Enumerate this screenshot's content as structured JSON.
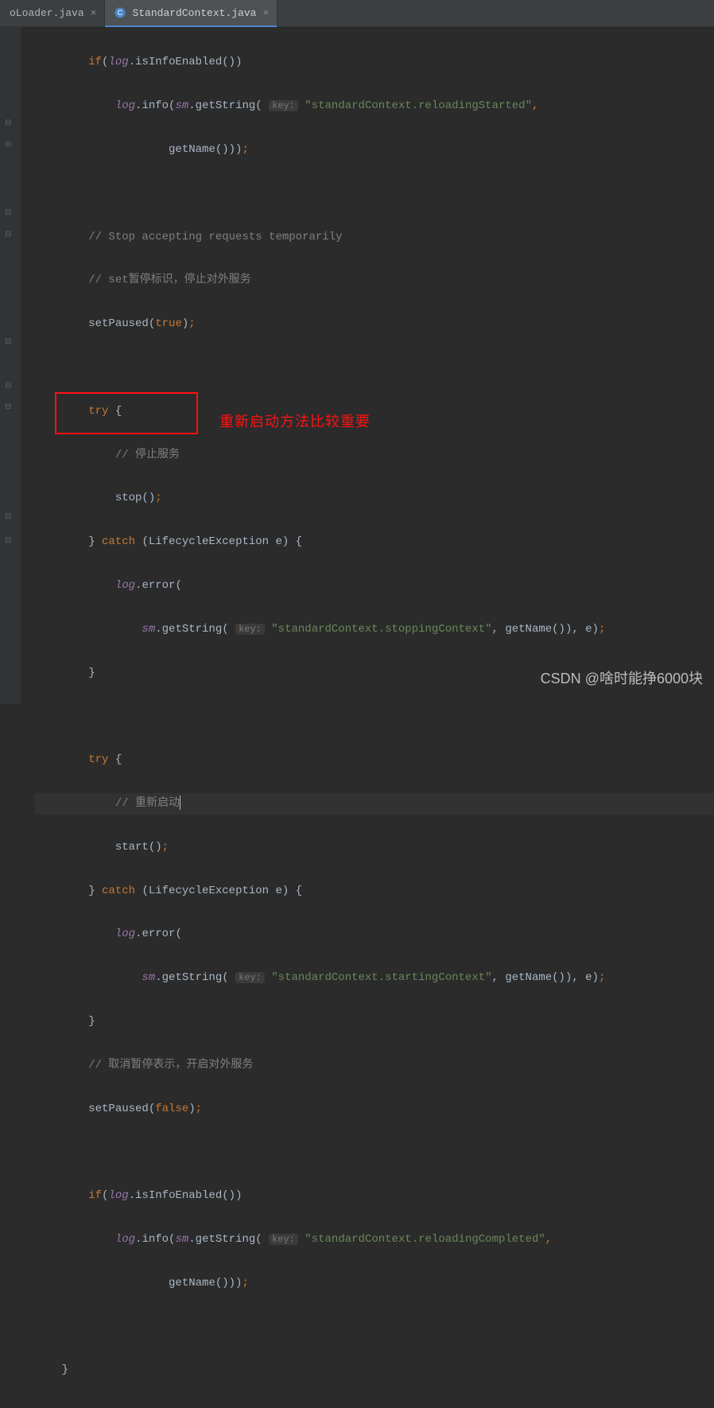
{
  "tabs": [
    {
      "label": "oLoader.java",
      "active": false,
      "icon": "none"
    },
    {
      "label": "StandardContext.java",
      "active": true,
      "icon": "class-icon"
    }
  ],
  "annotation": {
    "text": "重新启动方法比较重要"
  },
  "watermark": "CSDN @啥时能挣6000块",
  "code": {
    "l1a": "if",
    "l1b": "(",
    "l1c": "log",
    "l1d": ".isInfoEnabled())",
    "l2a": "log",
    "l2b": ".info(",
    "l2c": "sm",
    "l2d": ".getString(",
    "l2e": "key:",
    "l2f": "\"standardContext.reloadingStarted\"",
    "l2g": ",",
    "l3a": "getName()))",
    "l3b": ";",
    "l4": "",
    "l5": "// Stop accepting requests temporarily",
    "l6": "// set暂停标识，停止对外服务",
    "l7a": "setPaused(",
    "l7b": "true",
    "l7c": ")",
    "l7d": ";",
    "l8": "",
    "l9a": "try",
    "l9b": " {",
    "l10": "// 停止服务",
    "l11a": "stop()",
    "l11b": ";",
    "l12a": "} ",
    "l12b": "catch",
    "l12c": " (LifecycleException e) {",
    "l13a": "log",
    "l13b": ".error(",
    "l14a": "sm",
    "l14b": ".getString(",
    "l14c": "key:",
    "l14d": "\"standardContext.stoppingContext\"",
    "l14e": ", getName()), e)",
    "l14f": ";",
    "l15": "}",
    "l16": "",
    "l17a": "try",
    "l17b": " {",
    "l18": "// 重新启动",
    "l19a": "start()",
    "l19b": ";",
    "l20a": "} ",
    "l20b": "catch",
    "l20c": " (LifecycleException e) {",
    "l21a": "log",
    "l21b": ".error(",
    "l22a": "sm",
    "l22b": ".getString(",
    "l22c": "key:",
    "l22d": "\"standardContext.startingContext\"",
    "l22e": ", getName()), e)",
    "l22f": ";",
    "l23": "}",
    "l24": "// 取消暂停表示，开启对外服务",
    "l25a": "setPaused(",
    "l25b": "false",
    "l25c": ")",
    "l25d": ";",
    "l26": "",
    "l27a": "if",
    "l27b": "(",
    "l27c": "log",
    "l27d": ".isInfoEnabled())",
    "l28a": "log",
    "l28b": ".info(",
    "l28c": "sm",
    "l28d": ".getString(",
    "l28e": "key:",
    "l28f": "\"standardContext.reloadingCompleted\"",
    "l28g": ",",
    "l29a": "getName()))",
    "l29b": ";",
    "l30": "",
    "l31": "}"
  },
  "indent": {
    "i2": "        ",
    "i3": "            ",
    "i4": "                ",
    "i5": "                    "
  }
}
